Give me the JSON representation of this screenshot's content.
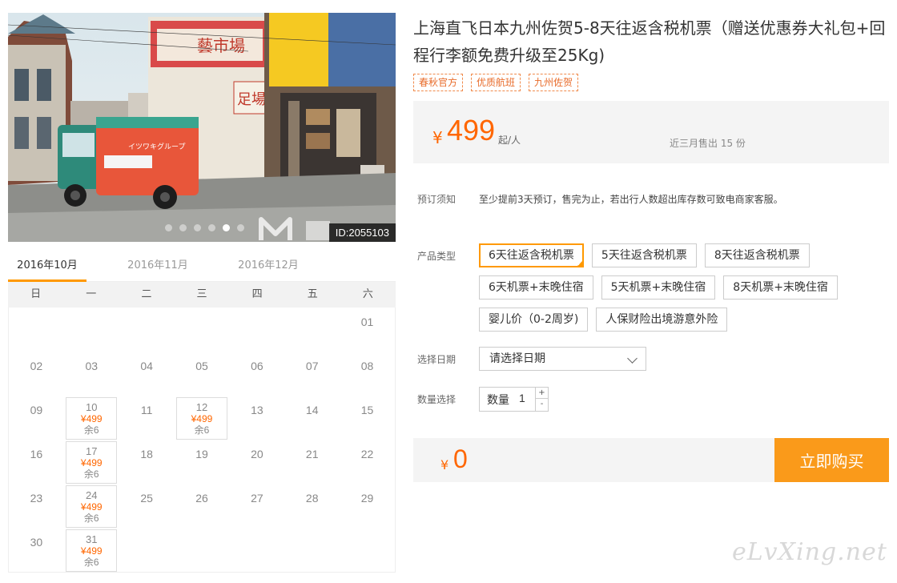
{
  "hero": {
    "id_label": "ID:2055103",
    "slide_count": 7,
    "active_slide": 5,
    "sign_market": "藝市場",
    "sign_foot": "足場",
    "truck_text": "イツワキグループ"
  },
  "calendar": {
    "months": [
      "2016年10月",
      "2016年11月",
      "2016年12月"
    ],
    "active_month": 0,
    "weekdays": [
      "日",
      "一",
      "二",
      "三",
      "四",
      "五",
      "六"
    ],
    "weeks": [
      [
        null,
        null,
        null,
        null,
        null,
        null,
        {
          "day": "01"
        }
      ],
      [
        {
          "day": "02"
        },
        {
          "day": "03"
        },
        {
          "day": "04"
        },
        {
          "day": "05"
        },
        {
          "day": "06"
        },
        {
          "day": "07"
        },
        {
          "day": "08"
        }
      ],
      [
        {
          "day": "09"
        },
        {
          "day": "10",
          "price": "¥499",
          "stock": "余6"
        },
        {
          "day": "11"
        },
        {
          "day": "12",
          "price": "¥499",
          "stock": "余6"
        },
        {
          "day": "13"
        },
        {
          "day": "14"
        },
        {
          "day": "15"
        }
      ],
      [
        {
          "day": "16"
        },
        {
          "day": "17",
          "price": "¥499",
          "stock": "余6"
        },
        {
          "day": "18"
        },
        {
          "day": "19"
        },
        {
          "day": "20"
        },
        {
          "day": "21"
        },
        {
          "day": "22"
        }
      ],
      [
        {
          "day": "23"
        },
        {
          "day": "24",
          "price": "¥499",
          "stock": "余6"
        },
        {
          "day": "25"
        },
        {
          "day": "26"
        },
        {
          "day": "27"
        },
        {
          "day": "28"
        },
        {
          "day": "29"
        }
      ],
      [
        {
          "day": "30"
        },
        {
          "day": "31",
          "price": "¥499",
          "stock": "余6"
        },
        null,
        null,
        null,
        null,
        null
      ]
    ]
  },
  "product": {
    "title": "上海直飞日本九州佐贺5-8天往返含税机票（赠送优惠券大礼包+回程行李额免费升级至25Kg)",
    "tags": [
      "春秋官方",
      "优质航班",
      "九州佐贺"
    ]
  },
  "price": {
    "currency": "¥",
    "amount": "499",
    "unit": "起/人",
    "sold_text": "近三月售出 15 份"
  },
  "notice": {
    "label": "预订须知",
    "text": "至少提前3天预订，售完为止，若出行人数超出库存数可致电商家客服。"
  },
  "product_type": {
    "label": "产品类型",
    "options": [
      "6天往返含税机票",
      "5天往返含税机票",
      "8天往返含税机票",
      "6天机票+末晚住宿",
      "5天机票+末晚住宿",
      "8天机票+末晚住宿",
      "婴儿价（0-2周岁)",
      "人保财险出境游意外险"
    ],
    "selected": 0
  },
  "date": {
    "label": "选择日期",
    "placeholder": "请选择日期"
  },
  "quantity": {
    "label": "数量选择",
    "field_label": "数量",
    "value": "1",
    "plus": "+",
    "minus": "-"
  },
  "checkout": {
    "currency": "¥",
    "total": "0",
    "buy_label": "立即购买"
  },
  "watermark": "eLvXing.net",
  "colors": {
    "accent": "#ff6600",
    "button": "#fa9a1a",
    "selected_border": "#ff9900"
  }
}
